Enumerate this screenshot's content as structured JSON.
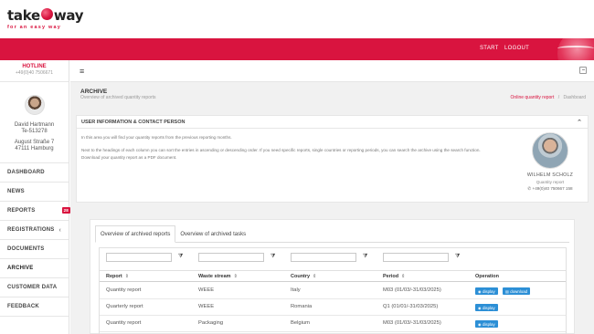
{
  "brand": {
    "logo_left": "take",
    "logo_right": "way",
    "tagline": "for an easy way"
  },
  "nav": {
    "start": "START",
    "logout": "LOGOUT"
  },
  "sidebar": {
    "hotline_label": "HOTLINE",
    "hotline_number": "+49(0)40 7506671",
    "user_name": "David Hartmann",
    "user_phone": "Te-513278",
    "address_street": "August Straße 7",
    "address_city": "47111 Hamburg",
    "items": [
      {
        "label": "DASHBOARD"
      },
      {
        "label": "NEWS"
      },
      {
        "label": "REPORTS",
        "badge": "28"
      },
      {
        "label": "REGISTRATIONS",
        "caret": "‹"
      },
      {
        "label": "DOCUMENTS"
      },
      {
        "label": "ARCHIVE"
      },
      {
        "label": "CUSTOMER DATA"
      },
      {
        "label": "FEEDBACK"
      }
    ]
  },
  "page": {
    "title": "ARCHIVE",
    "subtitle": "Overview of archived quantity reports",
    "breadcrumb_link": "Online quantity report",
    "breadcrumb_sep": "/",
    "breadcrumb_current": "Dashboard"
  },
  "info": {
    "heading": "USER INFORMATION & CONTACT PERSON",
    "line1": "In this area you will find your quantity reports from the previous reporting months.",
    "line2": "Next to the headings of each column you can sort the entries in ascending or descending order. If you need specific reports, single countries or reporting periods, you can search the archive using the search function.",
    "line3": "Download your quantity report as a PDF document.",
    "contact_name": "WILHELM SCHOLZ",
    "contact_role": "Quantity report",
    "contact_phone": "+49(0)40 750667 158"
  },
  "tabs": [
    {
      "label": "Overview of archived reports"
    },
    {
      "label": "Overview of archived tasks"
    }
  ],
  "table": {
    "headers": [
      "Report",
      "Waste stream",
      "Country",
      "Period",
      "Operation"
    ],
    "sort_glyph": "⇕",
    "filter_glyph": "⧩",
    "rows": [
      {
        "report": "Quantity report",
        "waste": "WEEE",
        "country": "Italy",
        "period": "M03 (01/03/-31/03/2025)",
        "actions": [
          "display",
          "download"
        ]
      },
      {
        "report": "Quarterly report",
        "waste": "WEEE",
        "country": "Romania",
        "period": "Q1 (01/01/-31/03/2025)",
        "actions": [
          "display"
        ]
      },
      {
        "report": "Quantity report",
        "waste": "Packaging",
        "country": "Belgium",
        "period": "M03 (01/03/-31/03/2025)",
        "actions": [
          "display"
        ]
      }
    ]
  },
  "icons": {
    "hamburger": "menu-icon",
    "exit": "logout-icon",
    "chevron": "chevron-up-icon",
    "eye": "eye-icon",
    "download": "download-icon",
    "phone": "phone-icon"
  },
  "colors": {
    "brand_red": "#d9143f",
    "button_blue": "#2c8fd6",
    "content_bg": "#f1f1f1"
  }
}
